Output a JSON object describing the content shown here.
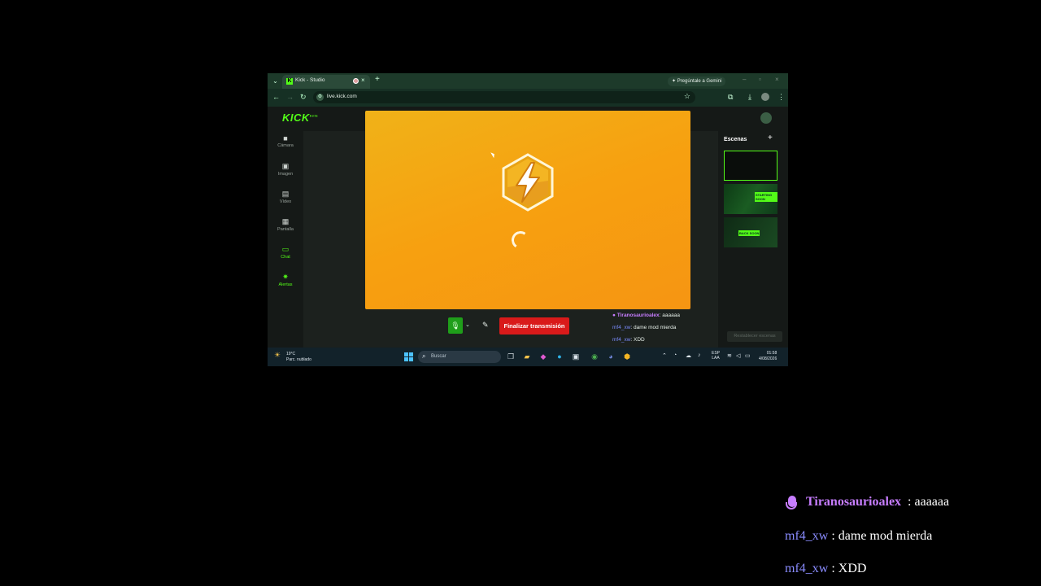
{
  "browser": {
    "tab_title": "Kick - Studio",
    "tab_favicon": "K",
    "new_tab": "+",
    "gemini_label": "Pregúntale a Gemini",
    "url": "live.kick.com"
  },
  "studio": {
    "logo": "KICK",
    "logo_sup": "beta",
    "sidebar": [
      {
        "label": "Cámara",
        "icon": "camera-icon"
      },
      {
        "label": "Imagen",
        "icon": "image-icon"
      },
      {
        "label": "Vídeo",
        "icon": "film-icon"
      },
      {
        "label": "Pantalla",
        "icon": "screen-icon"
      },
      {
        "label": "Chat",
        "icon": "chat-icon"
      },
      {
        "label": "Alertas",
        "icon": "confetti-icon"
      }
    ],
    "end_button": "Finalizar transmisión",
    "scenes_title": "Escenas",
    "scenes_add": "+",
    "scene_badge_2": "STARTING SOON",
    "scene_badge_3": "BACK SOON",
    "reset_scenes": "Restablecer escenas",
    "chat": [
      {
        "user": "Tiranosaurioalex",
        "text": ": aaaaaa"
      },
      {
        "user": "mf4_xw",
        "text": ": dame mod mierda"
      },
      {
        "user": "mf4_xw",
        "text": ": XDD"
      }
    ]
  },
  "taskbar": {
    "temp": "19°C",
    "weather": "Parc. nublado",
    "search_placeholder": "Buscar",
    "lang_top": "ESP",
    "lang_bottom": "LAA",
    "time": "01:58",
    "date": "4/08/2026"
  },
  "overlay_chat": [
    {
      "user": "Tiranosaurioalex",
      "text": ": aaaaaa"
    },
    {
      "user": "mf4_xw",
      "text": ": dame mod mierda"
    },
    {
      "user": "mf4_xw",
      "text": ": XDD"
    }
  ],
  "colors": {
    "kick_green": "#53fc18",
    "end_red": "#d91a1a",
    "preview_orange": "#f7a010",
    "user_purple": "#c77dff",
    "user_blue": "#7b8cff"
  }
}
